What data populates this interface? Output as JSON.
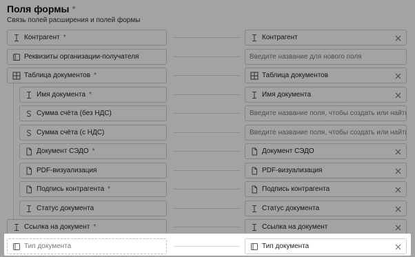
{
  "header": {
    "title": "Поля формы",
    "required_mark": "*",
    "subtitle": "Связь полей расширения и полей формы"
  },
  "rows": [
    {
      "left": {
        "label": "Контрагент",
        "icon": "text-field-icon",
        "required": "*"
      },
      "right": {
        "label": "Контрагент",
        "icon": "text-field-icon",
        "filled": true
      }
    },
    {
      "left": {
        "label": "Реквизиты организации-получателя",
        "icon": "requisites-icon",
        "required": ""
      },
      "right": {
        "placeholder": "Введите название для нового поля",
        "filled": false
      }
    },
    {
      "left": {
        "label": "Таблица документов",
        "icon": "table-icon",
        "required": "*"
      },
      "right": {
        "label": "Таблица документов",
        "icon": "table-icon",
        "filled": true
      }
    },
    {
      "left": {
        "label": "Имя документа",
        "icon": "text-field-icon",
        "required": "*"
      },
      "right": {
        "label": "Имя документа",
        "icon": "text-field-icon",
        "filled": true
      }
    },
    {
      "left": {
        "label": "Сумма счёта (без НДС)",
        "icon": "currency-icon",
        "required": ""
      },
      "right": {
        "placeholder": "Введите название поля, чтобы создать или найти",
        "filled": false
      }
    },
    {
      "left": {
        "label": "Сумма счёта (с НДС)",
        "icon": "currency-icon",
        "required": ""
      },
      "right": {
        "placeholder": "Введите название поля, чтобы создать или найти",
        "filled": false
      }
    },
    {
      "left": {
        "label": "Документ СЭДО",
        "icon": "document-icon",
        "required": "*"
      },
      "right": {
        "label": "Документ СЭДО",
        "icon": "document-icon",
        "filled": true
      }
    },
    {
      "left": {
        "label": "PDF-визуализация",
        "icon": "document-icon",
        "required": ""
      },
      "right": {
        "label": "PDF-визуализация",
        "icon": "document-icon",
        "filled": true
      }
    },
    {
      "left": {
        "label": "Подпись контрагента",
        "icon": "document-icon",
        "required": "*"
      },
      "right": {
        "label": "Подпись контрагента",
        "icon": "document-icon",
        "filled": true
      }
    },
    {
      "left": {
        "label": "Статус документа",
        "icon": "text-field-icon",
        "required": ""
      },
      "right": {
        "label": "Статус документа",
        "icon": "text-field-icon",
        "filled": true
      }
    },
    {
      "left": {
        "label": "Ссылка на документ",
        "icon": "text-field-icon",
        "required": "*"
      },
      "right": {
        "label": "Ссылка на документ",
        "icon": "text-field-icon",
        "filled": true
      }
    },
    {
      "left": {
        "label": "Тип документа",
        "icon": "requisites-icon",
        "required": ""
      },
      "right": {
        "label": "Тип документа",
        "icon": "requisites-icon",
        "filled": true
      }
    }
  ],
  "colors": {
    "overlay": "rgba(0,0,0,0.36)",
    "border": "#cfcfcf",
    "text": "#222222",
    "placeholder": "#7a7a7a"
  }
}
